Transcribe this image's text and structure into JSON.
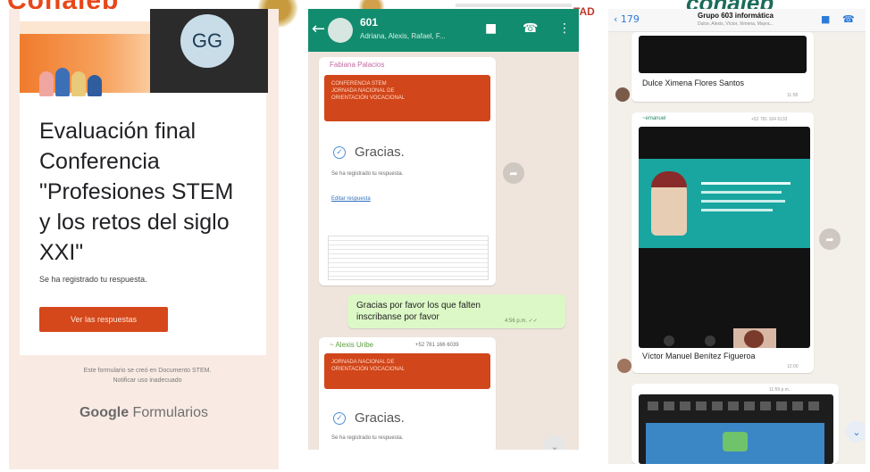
{
  "banner": {
    "left_text": "Conalep",
    "center_fragment": "TAD",
    "right_text": "conalep"
  },
  "form": {
    "avatar_initials": "GG",
    "title": "Evaluación final\nConferencia\n\"Profesiones STEM\ny los retos del siglo\nXXI\"",
    "subtitle": "Se ha registrado tu respuesta.",
    "button_label": "Ver las respuestas",
    "footer_line1": "Este formulario se creó en Documento STEM.",
    "footer_line2": "Notificar uso inadecuado",
    "brand_prefix": "Google",
    "brand_suffix": "Formularios"
  },
  "chat1": {
    "group_name": "601",
    "members": "Adriana, Alexis, Rafael, F...",
    "sender": "Fabiana Palacios",
    "card1_text": "CONFERENCIA STEM\nJORNADA NACIONAL DE\nORIENTACIÓN VOCACIONAL",
    "gracias1": "Gracias.",
    "response_note": "Se ha registrado tu respuesta.",
    "edit_link": "Editar respuesta",
    "outgoing_message": "Gracias por favor los que falten\ninscribanse por favor",
    "outgoing_time": "4:56 p.m. ✓✓",
    "sender2": "~ Alexis Uribe",
    "sender2_phone": "+52 781 166 6039",
    "card2_text": "JORNADA NACIONAL DE\nORIENTACIÓN VOCACIONAL",
    "gracias2": "Gracias.",
    "response_note2": "Se ha registrado tu respuesta."
  },
  "chat2": {
    "back_count": "179",
    "group_name": "Grupo 603 informática",
    "members": "Dulce, Alexis, Víctor, Ximena, Mayra...",
    "caption1": "Dulce Ximena Flores Santos",
    "time1": "11:58",
    "sender": "~emanuel",
    "sender_phone": "+52 781 164 6133",
    "caption2": "Víctor Manuel Benítez Figueroa",
    "time2": "12:00",
    "sender3_time": "11:59 p.m."
  }
}
